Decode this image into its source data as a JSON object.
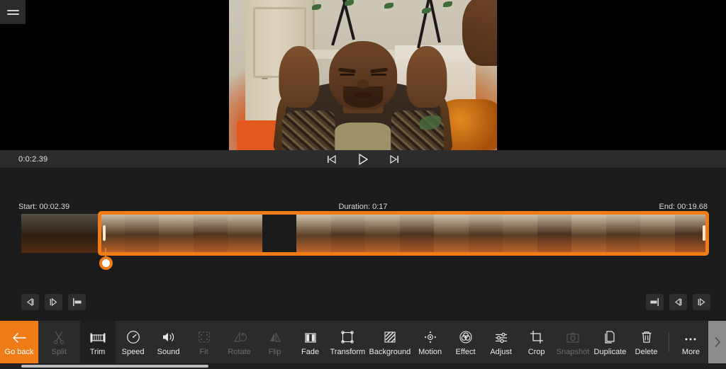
{
  "app": {
    "menu_icon": "hamburger-menu-icon"
  },
  "preview": {
    "scene_description": "Man sitting on orange couch holding his head with both hands"
  },
  "transport": {
    "timecode": "0:0:2.39",
    "prev_frame_icon": "skip-previous-icon",
    "play_icon": "play-icon",
    "next_frame_icon": "skip-next-icon"
  },
  "timeline": {
    "start_label": "Start: 00:02.39",
    "duration_label": "Duration: 0:17",
    "end_label": "End: 00:19.68",
    "left_buttons": [
      {
        "name": "step-back-button",
        "icon": "step-back-icon"
      },
      {
        "name": "step-forward-button",
        "icon": "step-forward-icon"
      },
      {
        "name": "set-in-point-button",
        "icon": "mark-in-icon"
      }
    ],
    "right_buttons": [
      {
        "name": "set-out-point-button",
        "icon": "mark-out-icon"
      },
      {
        "name": "step-back-button-right",
        "icon": "step-back-icon"
      },
      {
        "name": "step-forward-button-right",
        "icon": "step-forward-icon"
      }
    ]
  },
  "toolbar": {
    "items": [
      {
        "label": "Go back",
        "icon": "arrow-left-icon",
        "state": "goback"
      },
      {
        "label": "Split",
        "icon": "scissors-icon",
        "state": "disabled"
      },
      {
        "label": "Trim",
        "icon": "trim-icon",
        "state": "active"
      },
      {
        "label": "Speed",
        "icon": "speedometer-icon",
        "state": "normal"
      },
      {
        "label": "Sound",
        "icon": "speaker-icon",
        "state": "normal"
      },
      {
        "label": "Fit",
        "icon": "fit-icon",
        "state": "disabled"
      },
      {
        "label": "Rotate",
        "icon": "rotate-icon",
        "state": "disabled"
      },
      {
        "label": "Flip",
        "icon": "flip-icon",
        "state": "disabled"
      },
      {
        "label": "Fade",
        "icon": "fade-icon",
        "state": "normal"
      },
      {
        "label": "Transform",
        "icon": "transform-icon",
        "state": "normal"
      },
      {
        "label": "Background",
        "icon": "background-icon",
        "state": "normal"
      },
      {
        "label": "Motion",
        "icon": "motion-icon",
        "state": "normal"
      },
      {
        "label": "Effect",
        "icon": "effect-icon",
        "state": "normal"
      },
      {
        "label": "Adjust",
        "icon": "sliders-icon",
        "state": "normal"
      },
      {
        "label": "Crop",
        "icon": "crop-icon",
        "state": "normal"
      },
      {
        "label": "Snapshot",
        "icon": "camera-icon",
        "state": "disabled"
      },
      {
        "label": "Duplicate",
        "icon": "duplicate-icon",
        "state": "normal"
      },
      {
        "label": "Delete",
        "icon": "trash-icon",
        "state": "normal"
      },
      {
        "label": "More",
        "icon": "ellipsis-icon",
        "state": "normal"
      }
    ],
    "scroll_next_icon": "chevron-right-icon"
  },
  "colors": {
    "accent": "#f07c17",
    "toolbar_bg": "#2b2b2b",
    "timeline_bg": "#1b1b1b",
    "text": "#e9e9e9",
    "disabled_text": "#6d6d6d"
  }
}
